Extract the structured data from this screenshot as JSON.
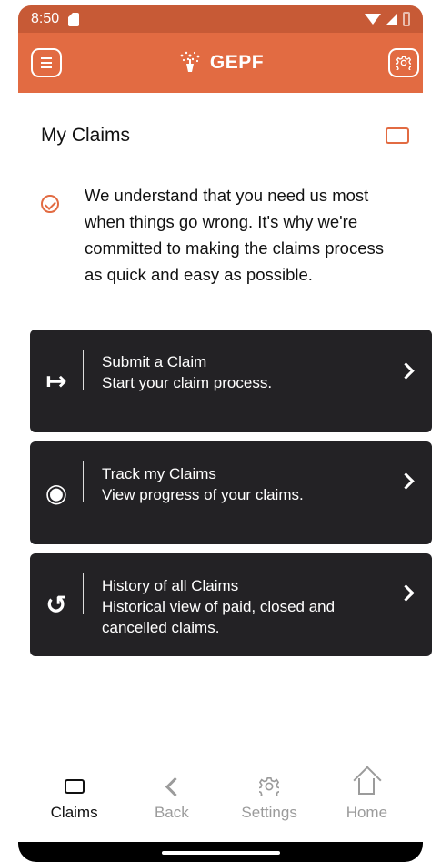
{
  "status_bar": {
    "time": "8:50",
    "sd_icon": "sd-card-icon",
    "wifi_icon": "wifi-icon",
    "signal_icon": "cell-signal-icon",
    "battery_icon": "battery-icon"
  },
  "app_bar": {
    "title": "GEPF",
    "menu_icon": "menu-icon",
    "settings_icon": "gear-icon",
    "brand_color": "#e26b42"
  },
  "page": {
    "title": "My Claims",
    "intro_text": "We understand that you need us most when things go wrong. It's why we're committed to making the claims process as quick and easy as possible."
  },
  "cards": [
    {
      "title": "Submit a Claim",
      "subtitle": "Start your claim process.",
      "icon": "submit-arrow-icon"
    },
    {
      "title": "Track my Claims",
      "subtitle": "View progress of your claims.",
      "icon": "track-progress-icon"
    },
    {
      "title": "History of all Claims",
      "subtitle": "Historical view of paid, closed and cancelled claims.",
      "icon": "history-icon"
    }
  ],
  "bottom_nav": [
    {
      "label": "Claims",
      "icon": "claims-icon",
      "active": true
    },
    {
      "label": "Back",
      "icon": "chevron-left-icon",
      "active": false
    },
    {
      "label": "Settings",
      "icon": "gear-icon",
      "active": false
    },
    {
      "label": "Home",
      "icon": "home-icon",
      "active": false
    }
  ],
  "colors": {
    "accent": "#e26b42",
    "card_background": "#232225",
    "inactive_nav": "#9b9b9b"
  }
}
